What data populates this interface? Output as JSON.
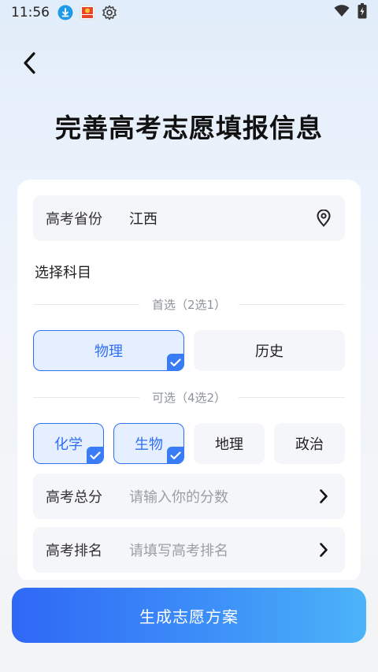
{
  "status_bar": {
    "time": "11:56"
  },
  "header": {
    "title": "完善高考志愿填报信息"
  },
  "province_field": {
    "label": "高考省份",
    "value": "江西"
  },
  "subjects": {
    "section_label": "选择科目",
    "primary_divider": "首选（2选1）",
    "primary_options": [
      {
        "label": "物理",
        "selected": true
      },
      {
        "label": "历史",
        "selected": false
      }
    ],
    "optional_divider": "可选（4选2）",
    "optional_options": [
      {
        "label": "化学",
        "selected": true
      },
      {
        "label": "生物",
        "selected": true
      },
      {
        "label": "地理",
        "selected": false
      },
      {
        "label": "政治",
        "selected": false
      }
    ]
  },
  "score_field": {
    "label": "高考总分",
    "placeholder": "请输入你的分数"
  },
  "rank_field": {
    "label": "高考排名",
    "placeholder": "请填写高考排名"
  },
  "submit_button": {
    "label": "生成志愿方案"
  },
  "colors": {
    "accent": "#2e6ff5",
    "selected_bg": "#e6efff",
    "button_gradient_start": "#2f68f6",
    "button_gradient_end": "#4cb4f9"
  }
}
